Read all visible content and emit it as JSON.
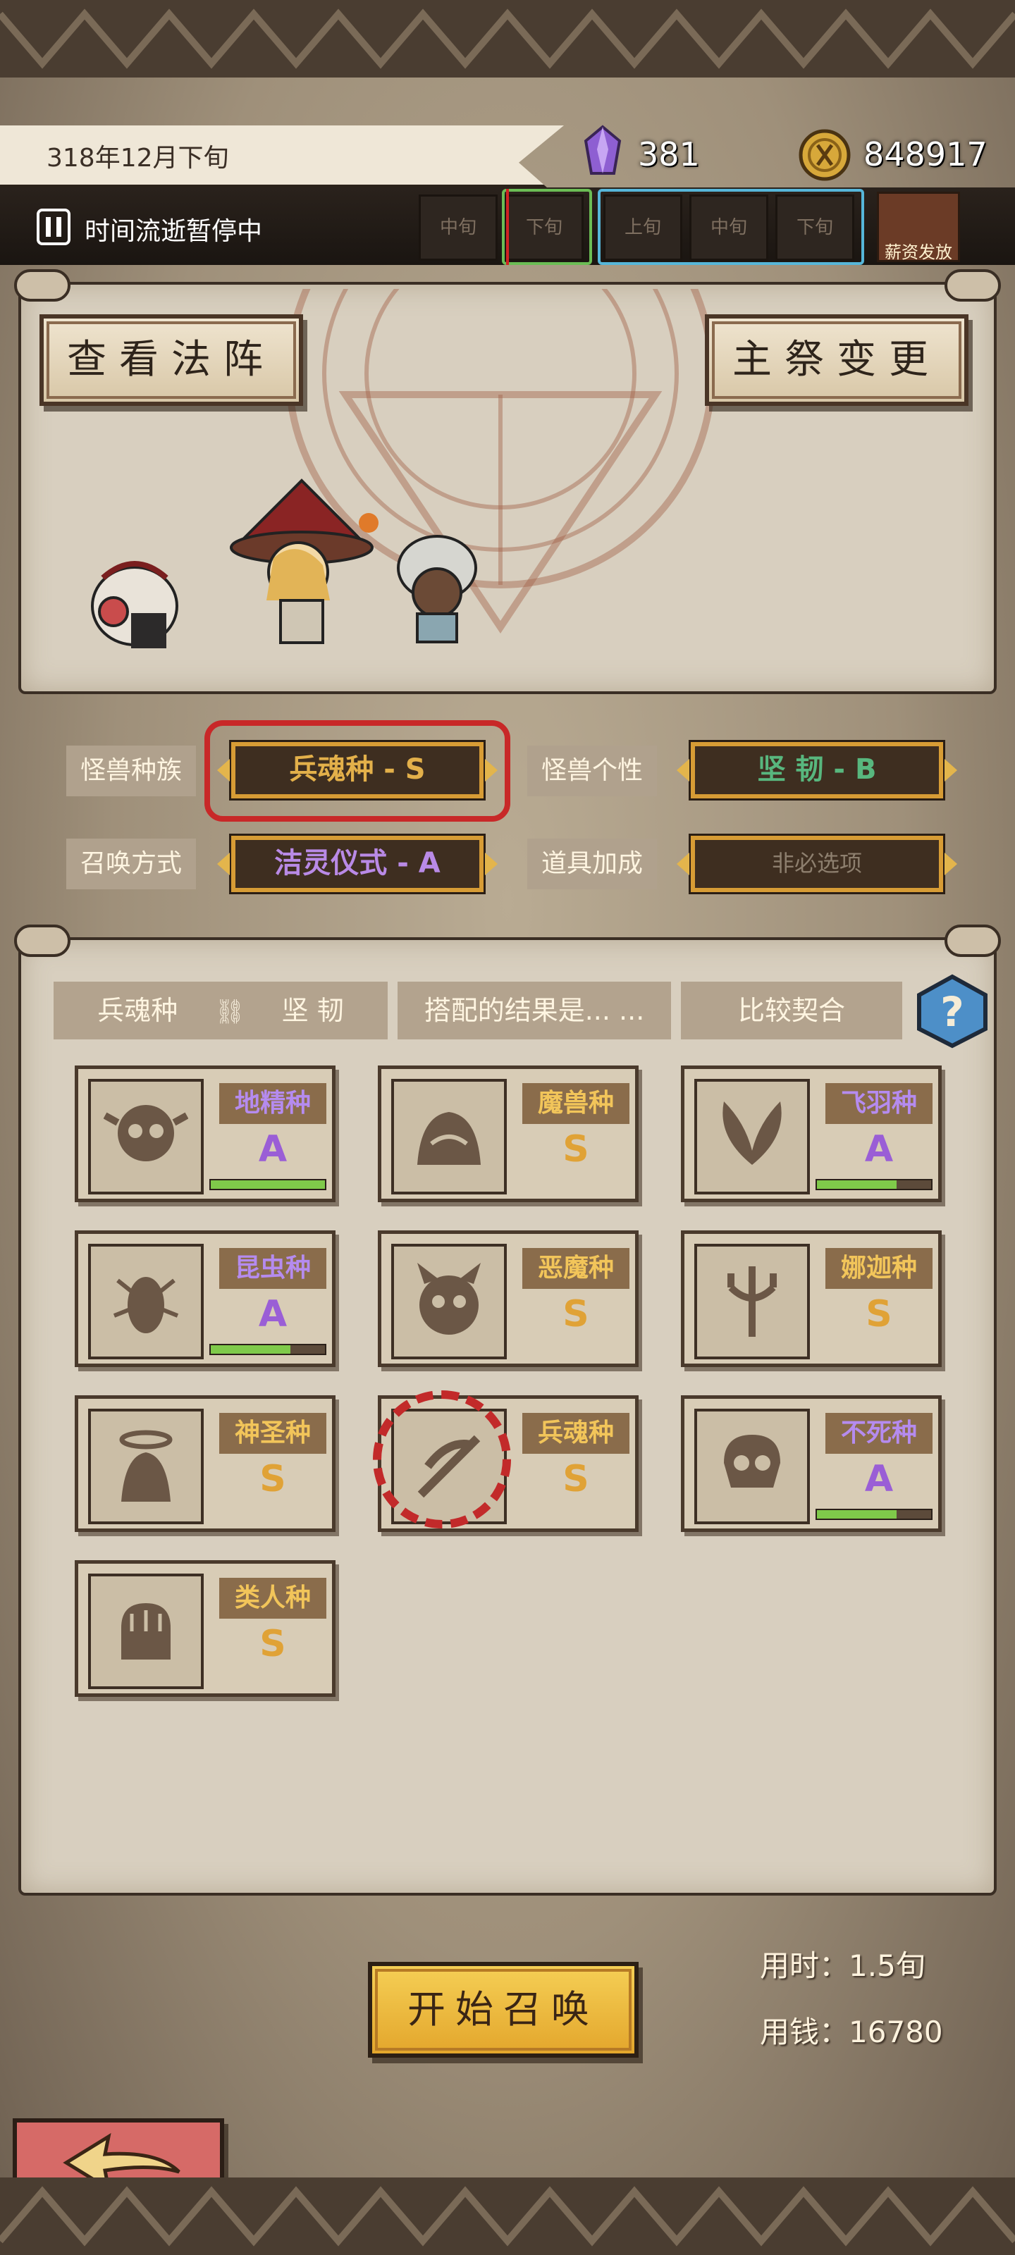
{
  "status": {
    "date": "318年12月下旬",
    "crystals": "381",
    "coins": "848917",
    "pause_text": "时间流逝暂停中",
    "slots": [
      "中旬",
      "下旬",
      "上旬",
      "中旬",
      "下旬"
    ],
    "salary_label": "薪资发放"
  },
  "panel_top": {
    "view_formation": "查看法阵",
    "change_priest": "主祭变更"
  },
  "selectors": {
    "race_label": "怪兽种族",
    "race_value": "兵魂种 - S",
    "personality_label": "怪兽个性",
    "personality_value": "坚 韧 - B",
    "method_label": "召唤方式",
    "method_value": "洁灵仪式 - A",
    "item_label": "道具加成",
    "item_value": "非必选项"
  },
  "combo": {
    "race": "兵魂种",
    "personality": "坚 韧",
    "result": "搭配的结果是... ...",
    "compare": "比较契合"
  },
  "races": [
    {
      "name": "地精种",
      "grade": "A",
      "tier": "purple",
      "progress": 1.0
    },
    {
      "name": "魔兽种",
      "grade": "S",
      "tier": "gold",
      "progress": null
    },
    {
      "name": "飞羽种",
      "grade": "A",
      "tier": "purple",
      "progress": 0.7
    },
    {
      "name": "昆虫种",
      "grade": "A",
      "tier": "purple",
      "progress": 0.7
    },
    {
      "name": "恶魔种",
      "grade": "S",
      "tier": "gold",
      "progress": null
    },
    {
      "name": "娜迦种",
      "grade": "S",
      "tier": "gold",
      "progress": null
    },
    {
      "name": "神圣种",
      "grade": "S",
      "tier": "gold",
      "progress": null
    },
    {
      "name": "兵魂种",
      "grade": "S",
      "tier": "gold",
      "progress": null
    },
    {
      "name": "不死种",
      "grade": "A",
      "tier": "purple",
      "progress": 0.7
    },
    {
      "name": "类人种",
      "grade": "S",
      "tier": "gold",
      "progress": null
    }
  ],
  "footer": {
    "start_summon": "开始召唤",
    "time_cost": "用时：1.5旬",
    "money_cost": "用钱：16780"
  },
  "colors": {
    "purple": "#9a5ed6",
    "gold": "#e0a236",
    "green_bar": "#7fca4a",
    "selection_red": "#c82828"
  }
}
